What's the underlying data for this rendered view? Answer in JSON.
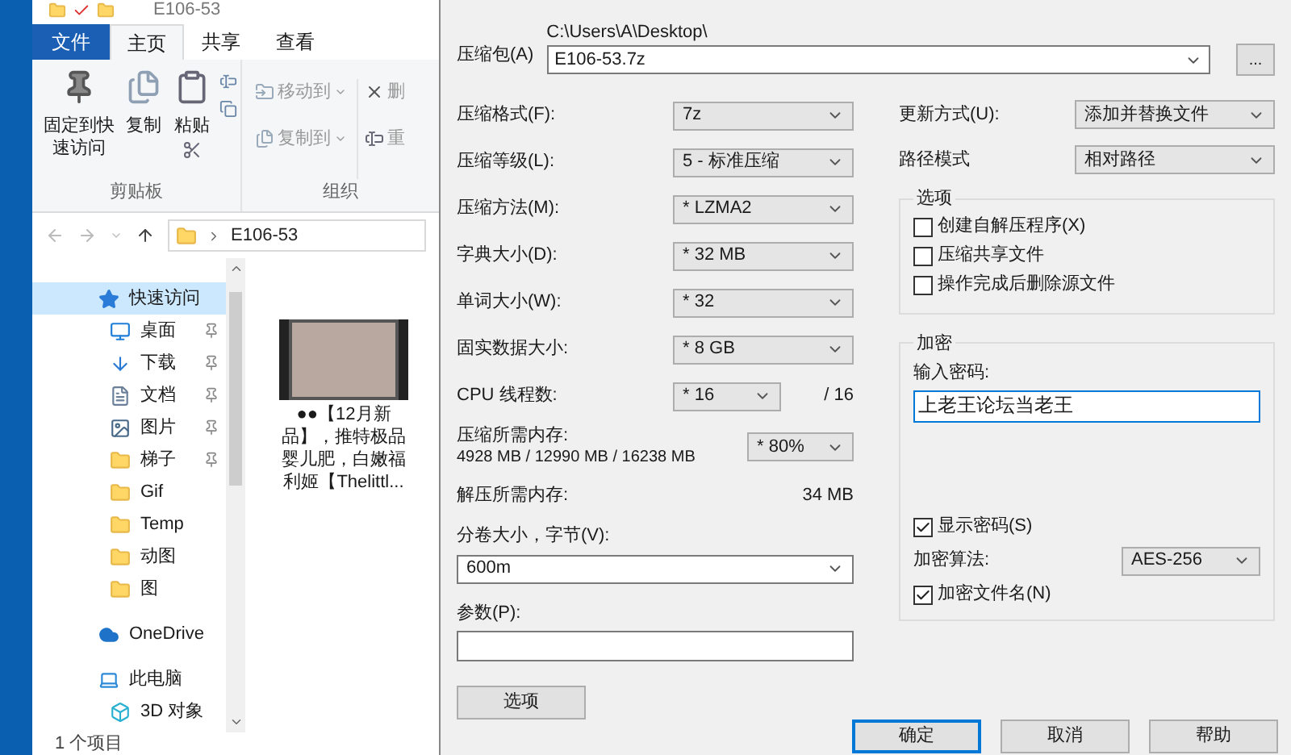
{
  "explorer": {
    "title": "E106-53",
    "tabs": [
      {
        "label": "文件",
        "kind": "file",
        "selected": false
      },
      {
        "label": "主页",
        "kind": "tab",
        "selected": true
      },
      {
        "label": "共享",
        "kind": "tab",
        "selected": false
      },
      {
        "label": "查看",
        "kind": "tab",
        "selected": false
      }
    ],
    "clipboard": {
      "label": "剪贴板",
      "pin": "固定到快速访问",
      "copy": "复制",
      "paste": "粘贴"
    },
    "organize": {
      "label": "组织",
      "move_to": "移动到",
      "copy_to": "复制到",
      "delete": "删",
      "rename": "重"
    },
    "address": {
      "path": "E106-53"
    },
    "nav": [
      {
        "label": "快速访问",
        "kind": "star",
        "selected": true,
        "pinned": false,
        "children": [
          {
            "label": "桌面",
            "kind": "desktop",
            "selected": false,
            "pinned": true
          },
          {
            "label": "下载",
            "kind": "download",
            "selected": false,
            "pinned": true
          },
          {
            "label": "文档",
            "kind": "document",
            "selected": false,
            "pinned": true
          },
          {
            "label": "图片",
            "kind": "picture",
            "selected": false,
            "pinned": true
          },
          {
            "label": "梯子",
            "kind": "folder",
            "selected": false,
            "pinned": true
          },
          {
            "label": "Gif",
            "kind": "folder",
            "selected": false,
            "pinned": false
          },
          {
            "label": "Temp",
            "kind": "folder",
            "selected": false,
            "pinned": false
          },
          {
            "label": "动图",
            "kind": "folder",
            "selected": false,
            "pinned": false
          },
          {
            "label": "图",
            "kind": "folder",
            "selected": false,
            "pinned": false
          }
        ]
      },
      {
        "label": "OneDrive",
        "kind": "cloud",
        "selected": false,
        "pinned": false
      },
      {
        "label": "此电脑",
        "kind": "pc",
        "selected": false,
        "pinned": false,
        "children": [
          {
            "label": "3D 对象",
            "kind": "cube",
            "selected": false,
            "pinned": false
          }
        ]
      }
    ],
    "files": [
      {
        "caption": "●●【12月新品】，推特极品婴儿肥，白嫩福利姬【Thelittl..."
      }
    ],
    "status": "1 个项目"
  },
  "dialog": {
    "archive": {
      "label": "压缩包(A)",
      "path": "C:\\Users\\A\\Desktop\\",
      "value": "E106-53.7z",
      "browse": "..."
    },
    "left": [
      {
        "kind": "select",
        "label": "压缩格式(F):",
        "value": "7z"
      },
      {
        "kind": "select",
        "label": "压缩等级(L):",
        "value": "5 - 标准压缩"
      },
      {
        "kind": "select",
        "label": "压缩方法(M):",
        "value": "* LZMA2"
      },
      {
        "kind": "select",
        "label": "字典大小(D):",
        "value": "* 32 MB"
      },
      {
        "kind": "select",
        "label": "单词大小(W):",
        "value": "* 32"
      },
      {
        "kind": "select",
        "label": "固实数据大小:",
        "value": "* 8 GB"
      },
      {
        "kind": "cpu",
        "label": "CPU 线程数:",
        "value": "* 16",
        "max": "/ 16"
      },
      {
        "kind": "memory",
        "label": "压缩所需内存:",
        "detail": "4928 MB / 12990 MB / 16238 MB",
        "value": "* 80%"
      },
      {
        "kind": "info",
        "label": "解压所需内存:",
        "value": "34 MB"
      }
    ],
    "volume": {
      "label": "分卷大小，字节(V):",
      "value": "600m"
    },
    "params": {
      "label": "参数(P):"
    },
    "options_button": "选项",
    "right": [
      {
        "label": "更新方式(U):",
        "value": "添加并替换文件"
      },
      {
        "label": "路径模式",
        "value": "相对路径"
      }
    ],
    "options": {
      "title": "选项",
      "checkboxes": [
        {
          "label": "创建自解压程序(X)",
          "checked": false
        },
        {
          "label": "压缩共享文件",
          "checked": false
        },
        {
          "label": "操作完成后删除源文件",
          "checked": false
        }
      ]
    },
    "encryption": {
      "title": "加密",
      "password_label": "输入密码:",
      "password": "上老王论坛当老王",
      "show_password": {
        "label": "显示密码(S)",
        "checked": true
      },
      "method": {
        "label": "加密算法:",
        "value": "AES-256"
      },
      "encrypt_names": {
        "label": "加密文件名(N)",
        "checked": true
      }
    },
    "buttons": [
      {
        "label": "确定",
        "default": true
      },
      {
        "label": "取消",
        "default": false
      },
      {
        "label": "帮助",
        "default": false
      }
    ]
  }
}
